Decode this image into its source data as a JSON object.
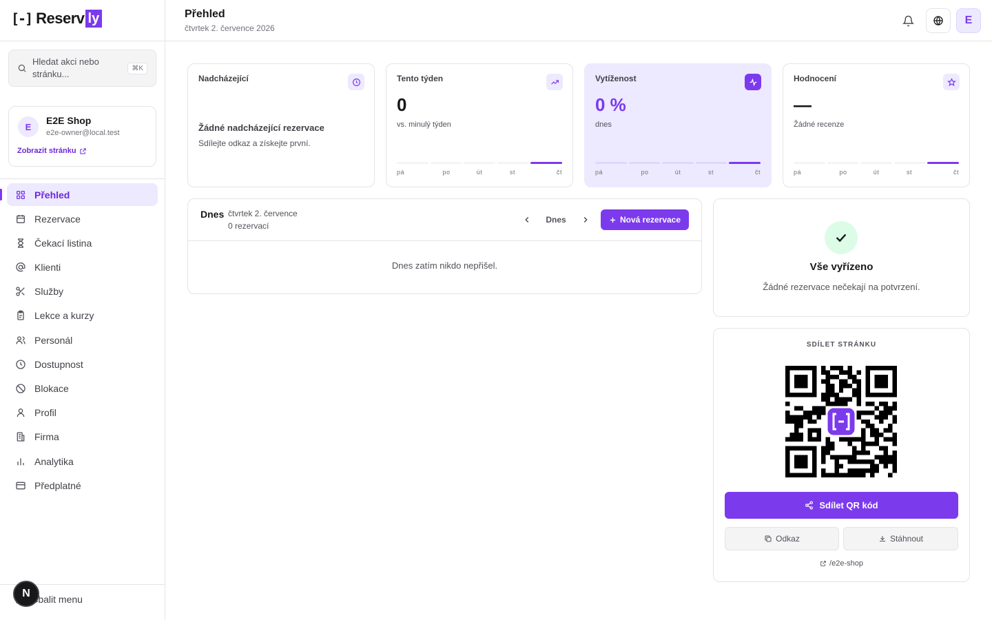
{
  "brand": {
    "bracket": "[-]",
    "word": "Reserv",
    "suffix": "ly",
    "accent": "#7c3aed"
  },
  "search": {
    "placeholder": "Hledat akci nebo stránku...",
    "shortcut": "⌘K"
  },
  "shop": {
    "initial": "E",
    "name": "E2E Shop",
    "email": "e2e-owner@local.test",
    "link_label": "Zobrazit stránku"
  },
  "nav": {
    "items": [
      {
        "label": "Přehled",
        "icon": "grid-icon",
        "active": true
      },
      {
        "label": "Rezervace",
        "icon": "calendar-icon"
      },
      {
        "label": "Čekací listina",
        "icon": "hourglass-icon"
      },
      {
        "label": "Klienti",
        "icon": "at-sign-icon"
      },
      {
        "label": "Služby",
        "icon": "scissors-icon"
      },
      {
        "label": "Lekce a kurzy",
        "icon": "clipboard-icon"
      },
      {
        "label": "Personál",
        "icon": "users-icon"
      },
      {
        "label": "Dostupnost",
        "icon": "clock-icon"
      },
      {
        "label": "Blokace",
        "icon": "ban-icon"
      },
      {
        "label": "Profil",
        "icon": "user-icon"
      },
      {
        "label": "Firma",
        "icon": "building-icon"
      },
      {
        "label": "Analytika",
        "icon": "bar-chart-icon"
      },
      {
        "label": "Předplatné",
        "icon": "credit-card-icon"
      }
    ],
    "collapse_label": "Sbalit menu",
    "dev_badge": "N"
  },
  "header": {
    "title": "Přehled",
    "date": "čtvrtek 2. července 2026",
    "user_initial": "E"
  },
  "stats": {
    "days": [
      "pá",
      "po",
      "út",
      "st",
      "čt"
    ],
    "upcoming": {
      "label": "Nadcházející",
      "icon": "clock-icon",
      "empty_title": "Žádné nadcházející rezervace",
      "empty_sub": "Sdílejte odkaz a získejte první."
    },
    "week": {
      "label": "Tento týden",
      "icon": "trending-up-icon",
      "value": "0",
      "sub": "vs. minulý týden"
    },
    "occupancy": {
      "label": "Vytíženost",
      "icon": "activity-icon",
      "value": "0 %",
      "sub": "dnes"
    },
    "rating": {
      "label": "Hodnocení",
      "icon": "star-icon",
      "value": "—",
      "sub": "Žádné recenze"
    }
  },
  "today": {
    "title": "Dnes",
    "date": "čtvrtek 2. července",
    "count": "0 rezervací",
    "today_button": "Dnes",
    "new_button": "Nová rezervace",
    "empty": "Dnes zatím nikdo nepřišel."
  },
  "pending": {
    "title": "Vše vyřízeno",
    "sub": "Žádné rezervace nečekají na potvrzení."
  },
  "share": {
    "heading": "SDÍLET STRÁNKU",
    "share_button": "Sdílet QR kód",
    "link_button": "Odkaz",
    "download_button": "Stáhnout",
    "slug": "/e2e-shop"
  }
}
